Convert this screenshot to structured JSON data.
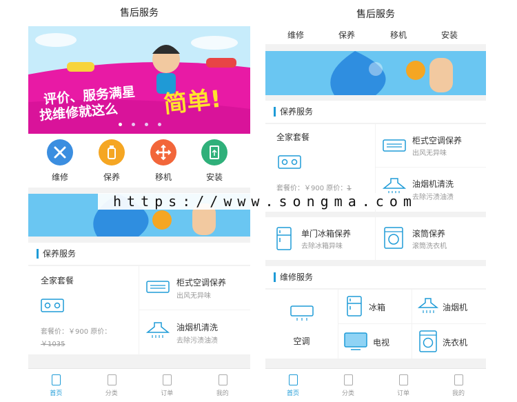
{
  "left": {
    "title": "售后服务",
    "banner": {
      "line1": "评价、服务满星",
      "line2": "找维修就这么",
      "emph": "简单!"
    },
    "grid": [
      {
        "label": "维修",
        "color": "#3b8ee0",
        "icon": "tools-icon"
      },
      {
        "label": "保养",
        "color": "#f5a623",
        "icon": "bottle-icon"
      },
      {
        "label": "移机",
        "color": "#f2663a",
        "icon": "move-arrows-icon"
      },
      {
        "label": "安装",
        "color": "#2fb07a",
        "icon": "install-icon"
      }
    ],
    "section": "保养服务",
    "package": {
      "title": "全家套餐",
      "price": "套餐价：￥900 原价：",
      "old": "￥1035"
    },
    "items": [
      {
        "title": "柜式空调保养",
        "sub": "出风无异味"
      },
      {
        "title": "油烟机清洗",
        "sub": "去除污渍油渍"
      }
    ],
    "tabs": [
      "首页",
      "分类",
      "订单",
      "我的"
    ]
  },
  "right": {
    "title": "售后服务",
    "subnav": [
      "维修",
      "保养",
      "移机",
      "安装"
    ],
    "section1": "保养服务",
    "package": {
      "title": "全家套餐",
      "price": "套餐价：￥900 原价：",
      "old": "1"
    },
    "items": [
      {
        "title": "柜式空调保养",
        "sub": "出风无异味"
      },
      {
        "title": "油烟机清洗",
        "sub": "去除污渍油渍"
      },
      {
        "title": "单门冰箱保养",
        "sub": "去除冰箱异味"
      },
      {
        "title": "滚筒保养",
        "sub": "滚筒洗衣机"
      }
    ],
    "section2": "维修服务",
    "repair": [
      "空调",
      "冰箱",
      "油烟机",
      "电视",
      "洗衣机"
    ],
    "tabs": [
      "首页",
      "分类",
      "订单",
      "我的"
    ]
  },
  "watermark": "https://www.songma.com",
  "colors": {
    "accent": "#1e9bd7",
    "banner_magenta": "#e81aa5",
    "sky": "#c7ecfb"
  }
}
